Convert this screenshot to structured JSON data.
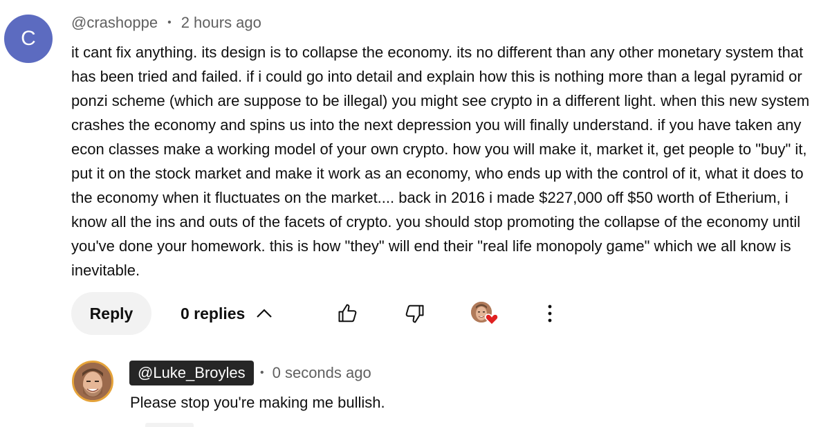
{
  "comment": {
    "avatar_letter": "C",
    "avatar_color": "#5c6bc0",
    "author": "@crashoppe",
    "separator": "•",
    "timestamp": "2 hours ago",
    "text": "it cant fix anything. its design is to collapse the economy. its no different than any other monetary system that has been tried and failed. if i could go into detail and explain how this is nothing more than a legal pyramid or ponzi scheme (which are suppose to be illegal) you might see crypto in a different light. when this new system crashes the economy and spins us into the next depression you will finally understand. if you have taken any econ classes make a working model of your own crypto. how you will make it, market it, get people to \"buy\" it, put it on the stock market and make it work as an economy, who ends up with the control of it, what it does to the economy when it fluctuates on the market.... back in 2016 i made $227,000 off $50 worth of Etherium, i know all the ins and outs of the facets of crypto. you should stop promoting the collapse of the economy until you've done your homework. this is how \"they\" will end their \"real life monopoly game\" which we all know is inevitable."
  },
  "actions": {
    "reply_label": "Reply",
    "replies_label": "0 replies",
    "replies_icon": "chevron-up-icon",
    "like_icon": "thumbs-up-icon",
    "dislike_icon": "thumbs-down-icon",
    "hearted_icon": "creator-heart-icon",
    "more_icon": "more-vertical-icon",
    "heart_color": "#e02020"
  },
  "reply": {
    "author": "@Luke_Broyles",
    "separator": "•",
    "timestamp": "0 seconds ago",
    "text": "Please stop you're making me bullish.",
    "avatar_ring_color": "#e5a33a"
  }
}
